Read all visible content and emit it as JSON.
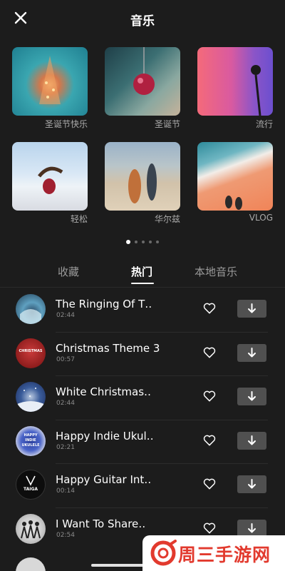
{
  "header": {
    "title": "音乐",
    "close_icon": "close-icon"
  },
  "categories": [
    {
      "label": "圣诞节快乐"
    },
    {
      "label": "圣诞节"
    },
    {
      "label": "流行"
    },
    {
      "label": "轻松"
    },
    {
      "label": "华尔兹"
    },
    {
      "label": "VLOG"
    }
  ],
  "carousel": {
    "page_count": 5,
    "active_page": 1
  },
  "tabs": [
    {
      "label": "收藏",
      "active": false
    },
    {
      "label": "热门",
      "active": true
    },
    {
      "label": "本地音乐",
      "active": false
    }
  ],
  "songs": [
    {
      "title": "The Ringing Of T‥",
      "duration": "02:44",
      "cover_text": ""
    },
    {
      "title": "Christmas Theme 3",
      "duration": "00:57",
      "cover_text": "CHRISTMAS"
    },
    {
      "title": "White Christmas‥",
      "duration": "02:44",
      "cover_text": ""
    },
    {
      "title": "Happy Indie Ukul‥",
      "duration": "02:21",
      "cover_text": "HAPPY INDIE UKULELE"
    },
    {
      "title": "Happy Guitar Int‥",
      "duration": "00:14",
      "cover_text": "TAIGA"
    },
    {
      "title": "I Want To Share‥",
      "duration": "02:54",
      "cover_text": ""
    }
  ],
  "watermark": {
    "text": "周三手游网"
  },
  "colors": {
    "background": "#1c1c1c",
    "text": "#ffffff",
    "muted": "#9a9a9a",
    "button": "#505050",
    "watermark": "#e23a2e"
  }
}
